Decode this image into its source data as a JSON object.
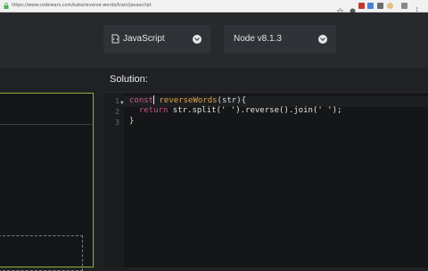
{
  "browser": {
    "url": "https://www.codewars.com/kata/reverse-words/train/javascript",
    "toolbar_icons": [
      "star-icon",
      "record-icon",
      "gmail-icon",
      "translate-icon",
      "extension-icon",
      "profile-icon",
      "menu-icon"
    ]
  },
  "language_dropdown": {
    "label": "JavaScript",
    "icon": "language-icon"
  },
  "version_dropdown": {
    "label": "Node v8.1.3"
  },
  "solution": {
    "title": "Solution:",
    "line_numbers": [
      "1",
      "2",
      "3"
    ],
    "code": {
      "line1": {
        "kw": "const",
        "fn": "reverseWords",
        "rest": "(str){"
      },
      "line2": {
        "kw": "return",
        "rest": " str.split(' ').reverse().join(' ');"
      },
      "line3": {
        "rest": "}"
      }
    }
  },
  "colors": {
    "keyword": "#c7588a",
    "function": "#e2a04e",
    "border_green": "#8bb33a",
    "background": "#1f2124"
  }
}
